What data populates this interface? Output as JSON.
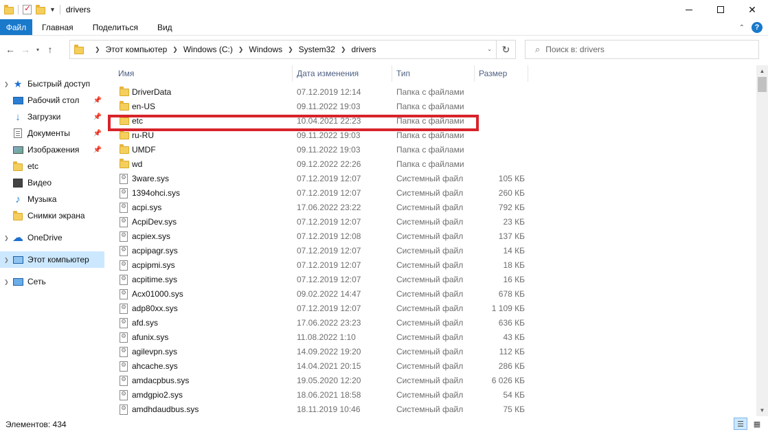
{
  "window": {
    "title": "drivers",
    "controls": {
      "minimize": "minimize",
      "maximize": "maximize",
      "close": "✕"
    }
  },
  "ribbon": {
    "file_tab": "Файл",
    "tabs": [
      "Главная",
      "Поделиться",
      "Вид"
    ]
  },
  "address": {
    "crumbs": [
      "Этот компьютер",
      "Windows (C:)",
      "Windows",
      "System32",
      "drivers"
    ]
  },
  "search": {
    "placeholder": "Поиск в: drivers"
  },
  "sidebar": {
    "items": [
      {
        "label": "Быстрый доступ",
        "icon": "star-icon",
        "pinned": false
      },
      {
        "label": "Рабочий стол",
        "icon": "desktop-icon",
        "pinned": true
      },
      {
        "label": "Загрузки",
        "icon": "download-icon",
        "pinned": true
      },
      {
        "label": "Документы",
        "icon": "documents-icon",
        "pinned": true
      },
      {
        "label": "Изображения",
        "icon": "pictures-icon",
        "pinned": true
      },
      {
        "label": "etc",
        "icon": "folder-icon",
        "pinned": false
      },
      {
        "label": "Видео",
        "icon": "video-icon",
        "pinned": false
      },
      {
        "label": "Музыка",
        "icon": "music-icon",
        "pinned": false
      },
      {
        "label": "Снимки экрана",
        "icon": "folder-icon",
        "pinned": false
      },
      {
        "label": "OneDrive",
        "icon": "onedrive-icon",
        "pinned": false
      },
      {
        "label": "Этот компьютер",
        "icon": "computer-icon",
        "pinned": false,
        "selected": true
      },
      {
        "label": "Сеть",
        "icon": "network-icon",
        "pinned": false
      }
    ]
  },
  "columns": {
    "name": "Имя",
    "date": "Дата изменения",
    "type": "Тип",
    "size": "Размер"
  },
  "files": [
    {
      "name": "DriverData",
      "date": "07.12.2019 12:14",
      "type": "Папка с файлами",
      "size": "",
      "kind": "folder"
    },
    {
      "name": "en-US",
      "date": "09.11.2022 19:03",
      "type": "Папка с файлами",
      "size": "",
      "kind": "folder"
    },
    {
      "name": "etc",
      "date": "10.04.2021 22:23",
      "type": "Папка с файлами",
      "size": "",
      "kind": "folder",
      "highlighted": true
    },
    {
      "name": "ru-RU",
      "date": "09.11.2022 19:03",
      "type": "Папка с файлами",
      "size": "",
      "kind": "folder"
    },
    {
      "name": "UMDF",
      "date": "09.11.2022 19:03",
      "type": "Папка с файлами",
      "size": "",
      "kind": "folder"
    },
    {
      "name": "wd",
      "date": "09.12.2022 22:26",
      "type": "Папка с файлами",
      "size": "",
      "kind": "folder"
    },
    {
      "name": "3ware.sys",
      "date": "07.12.2019 12:07",
      "type": "Системный файл",
      "size": "105 КБ",
      "kind": "sys"
    },
    {
      "name": "1394ohci.sys",
      "date": "07.12.2019 12:07",
      "type": "Системный файл",
      "size": "260 КБ",
      "kind": "sys"
    },
    {
      "name": "acpi.sys",
      "date": "17.06.2022 23:22",
      "type": "Системный файл",
      "size": "792 КБ",
      "kind": "sys"
    },
    {
      "name": "AcpiDev.sys",
      "date": "07.12.2019 12:07",
      "type": "Системный файл",
      "size": "23 КБ",
      "kind": "sys"
    },
    {
      "name": "acpiex.sys",
      "date": "07.12.2019 12:08",
      "type": "Системный файл",
      "size": "137 КБ",
      "kind": "sys"
    },
    {
      "name": "acpipagr.sys",
      "date": "07.12.2019 12:07",
      "type": "Системный файл",
      "size": "14 КБ",
      "kind": "sys"
    },
    {
      "name": "acpipmi.sys",
      "date": "07.12.2019 12:07",
      "type": "Системный файл",
      "size": "18 КБ",
      "kind": "sys"
    },
    {
      "name": "acpitime.sys",
      "date": "07.12.2019 12:07",
      "type": "Системный файл",
      "size": "16 КБ",
      "kind": "sys"
    },
    {
      "name": "Acx01000.sys",
      "date": "09.02.2022 14:47",
      "type": "Системный файл",
      "size": "678 КБ",
      "kind": "sys"
    },
    {
      "name": "adp80xx.sys",
      "date": "07.12.2019 12:07",
      "type": "Системный файл",
      "size": "1 109 КБ",
      "kind": "sys"
    },
    {
      "name": "afd.sys",
      "date": "17.06.2022 23:23",
      "type": "Системный файл",
      "size": "636 КБ",
      "kind": "sys"
    },
    {
      "name": "afunix.sys",
      "date": "11.08.2022 1:10",
      "type": "Системный файл",
      "size": "43 КБ",
      "kind": "sys"
    },
    {
      "name": "agilevpn.sys",
      "date": "14.09.2022 19:20",
      "type": "Системный файл",
      "size": "112 КБ",
      "kind": "sys"
    },
    {
      "name": "ahcache.sys",
      "date": "14.04.2021 20:15",
      "type": "Системный файл",
      "size": "286 КБ",
      "kind": "sys"
    },
    {
      "name": "amdacpbus.sys",
      "date": "19.05.2020 12:20",
      "type": "Системный файл",
      "size": "6 026 КБ",
      "kind": "sys"
    },
    {
      "name": "amdgpio2.sys",
      "date": "18.06.2021 18:58",
      "type": "Системный файл",
      "size": "54 КБ",
      "kind": "sys"
    },
    {
      "name": "amdhdaudbus.sys",
      "date": "18.11.2019 10:46",
      "type": "Системный файл",
      "size": "75 КБ",
      "kind": "sys"
    }
  ],
  "status": {
    "items_count": "Элементов: 434"
  },
  "colors": {
    "accent": "#1979ca",
    "highlight": "#d8232a",
    "selected_bg": "#cce8ff"
  }
}
